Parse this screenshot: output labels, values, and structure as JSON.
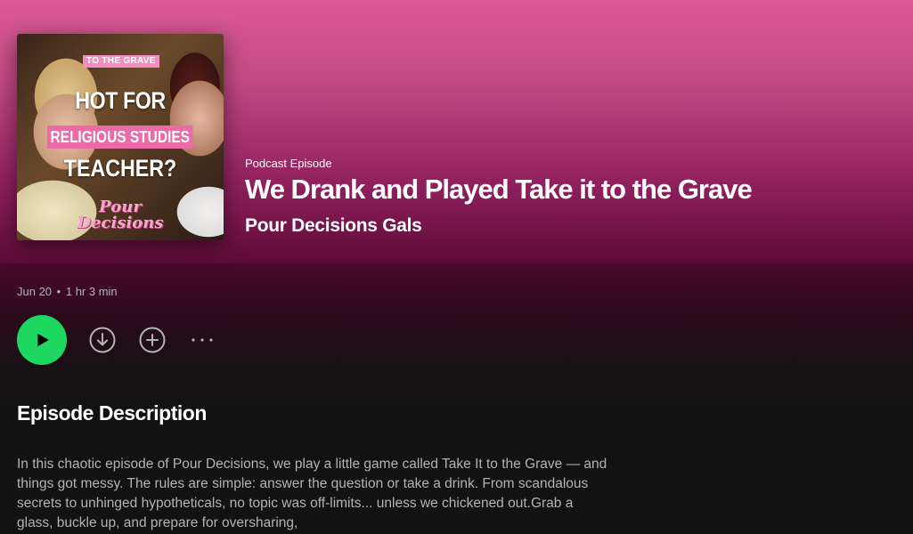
{
  "cover": {
    "tag": "TO THE GRAVE",
    "line1": "HOT FOR",
    "line2": "RELIGIOUS STUDIES",
    "line3": "TEACHER?",
    "logo_line1": "Pour",
    "logo_line2": "Decisions"
  },
  "header": {
    "type_label": "Podcast Episode",
    "title": "We Drank and Played Take it to the Grave",
    "show_name": "Pour Decisions Gals"
  },
  "meta": {
    "date": "Jun 20",
    "separator": "•",
    "duration": "1 hr 3 min"
  },
  "actions": {
    "play_icon": "play-icon",
    "download_icon": "download-icon",
    "add_icon": "add-icon",
    "more_icon": "more-options-icon"
  },
  "description": {
    "heading": "Episode Description",
    "text": "In this chaotic episode of Pour Decisions, we play a little game called Take It to the Grave — and things got messy. The rules are simple: answer the question or take a drink. From scandalous secrets to unhinged hypotheticals, no topic was off-limits... unless we chickened out.Grab a glass, buckle up, and prepare for oversharing,"
  },
  "colors": {
    "accent": "#1ed760",
    "hero_top": "#dc5a96",
    "hero_bottom": "#5a0a34",
    "background": "#121212",
    "muted_text": "#b3b3b3"
  }
}
